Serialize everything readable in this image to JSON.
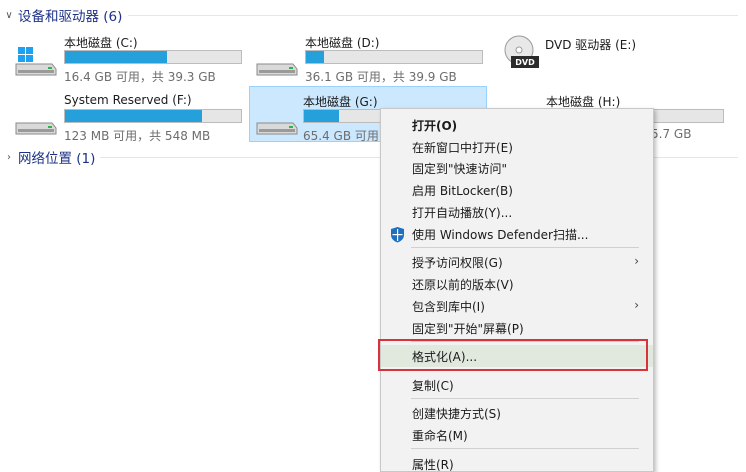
{
  "groups": {
    "devices": {
      "title": "设备和驱动器 (6)"
    },
    "network": {
      "title": "网络位置 (1)"
    }
  },
  "drives": [
    {
      "id": "c",
      "name": "本地磁盘 (C:)",
      "free": "16.4 GB 可用，共 39.3 GB",
      "used_fraction": 0.58,
      "icon": "windows-drive-icon"
    },
    {
      "id": "d",
      "name": "本地磁盘 (D:)",
      "free": "36.1 GB 可用，共 39.9 GB",
      "used_fraction": 0.1,
      "icon": "hard-drive-icon"
    },
    {
      "id": "e",
      "name": "DVD 驱动器 (E:)",
      "icon": "dvd-drive-icon",
      "badge": "DVD"
    },
    {
      "id": "f",
      "name": "System Reserved (F:)",
      "free": "123 MB 可用，共 548 MB",
      "used_fraction": 0.78,
      "icon": "hard-drive-icon"
    },
    {
      "id": "g",
      "name": "本地磁盘 (G:)",
      "free": "65.4 GB 可用",
      "used_fraction": 0.2,
      "icon": "hard-drive-icon",
      "selected": true
    },
    {
      "id": "h",
      "name": "本地磁盘 (H:)",
      "free_tail": "5.7 GB",
      "used_fraction": 0.03,
      "icon": "hard-drive-icon"
    }
  ],
  "context_menu": {
    "items": [
      {
        "label": "打开(O)",
        "bold": true
      },
      {
        "label": "在新窗口中打开(E)"
      },
      {
        "label": "固定到\"快速访问\""
      },
      {
        "label": "启用 BitLocker(B)"
      },
      {
        "label": "打开自动播放(Y)..."
      },
      {
        "label": "使用 Windows Defender扫描...",
        "icon": "windows-defender-shield-icon"
      },
      {
        "label": "授予访问权限(G)",
        "submenu": true
      },
      {
        "label": "还原以前的版本(V)"
      },
      {
        "label": "包含到库中(I)",
        "submenu": true
      },
      {
        "label": "固定到\"开始\"屏幕(P)"
      },
      {
        "label": "格式化(A)...",
        "highlighted": true
      },
      {
        "label": "复制(C)"
      },
      {
        "label": "创建快捷方式(S)"
      },
      {
        "label": "重命名(M)"
      },
      {
        "label": "属性(R)"
      }
    ]
  },
  "colors": {
    "accent_bar": "#26a0da",
    "selection": "#cce8ff",
    "group_header": "#1e3287",
    "annotation": "#d8323b"
  }
}
